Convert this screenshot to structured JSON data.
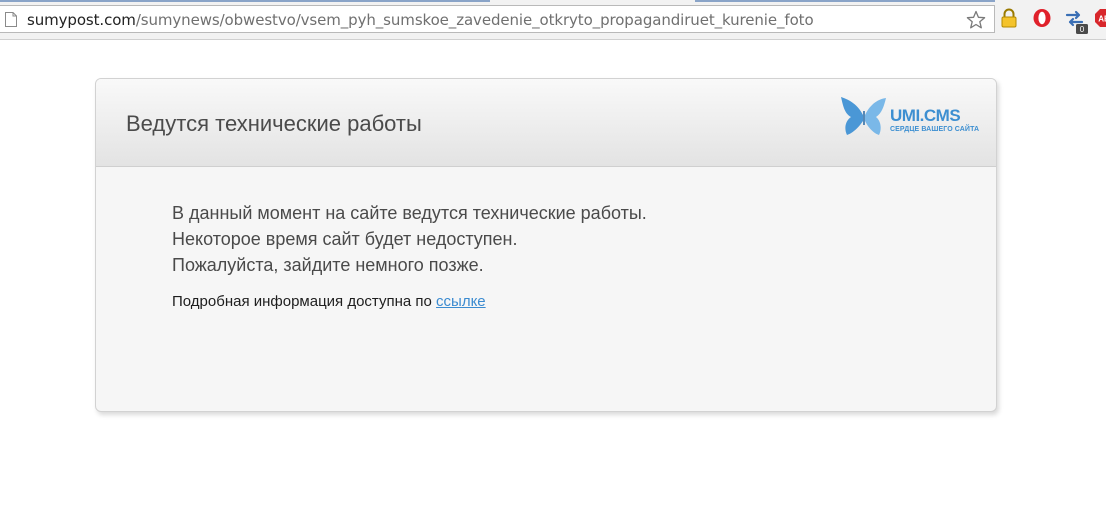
{
  "browser": {
    "url_host": "sumypost.com",
    "url_path": "/sumynews/obwestvo/vsem_pyh_sumskoe_zavedenie_otkryto_propagandiruet_kurenie_foto",
    "extensions": [
      "star-icon",
      "lock-icon",
      "opera-icon",
      "sync-icon",
      "adblock-icon"
    ],
    "sync_badge": "0",
    "adblock_label": "AB"
  },
  "panel": {
    "title": "Ведутся технические работы",
    "logo_text": "UMI.CMS",
    "logo_tagline": "СЕРДЦЕ ВАШЕГО САЙТА",
    "message_lines": [
      "В данный момент на сайте ведутся технические работы.",
      "Некоторое время сайт будет недоступен.",
      "Пожалуйста, зайдите немного позже."
    ],
    "more_info_text": "Подробная информация доступна по",
    "more_info_link": "ссылке"
  },
  "colors": {
    "accent": "#3d8fd1",
    "link": "#3b8bd0",
    "panel_bg": "#f6f6f6"
  }
}
